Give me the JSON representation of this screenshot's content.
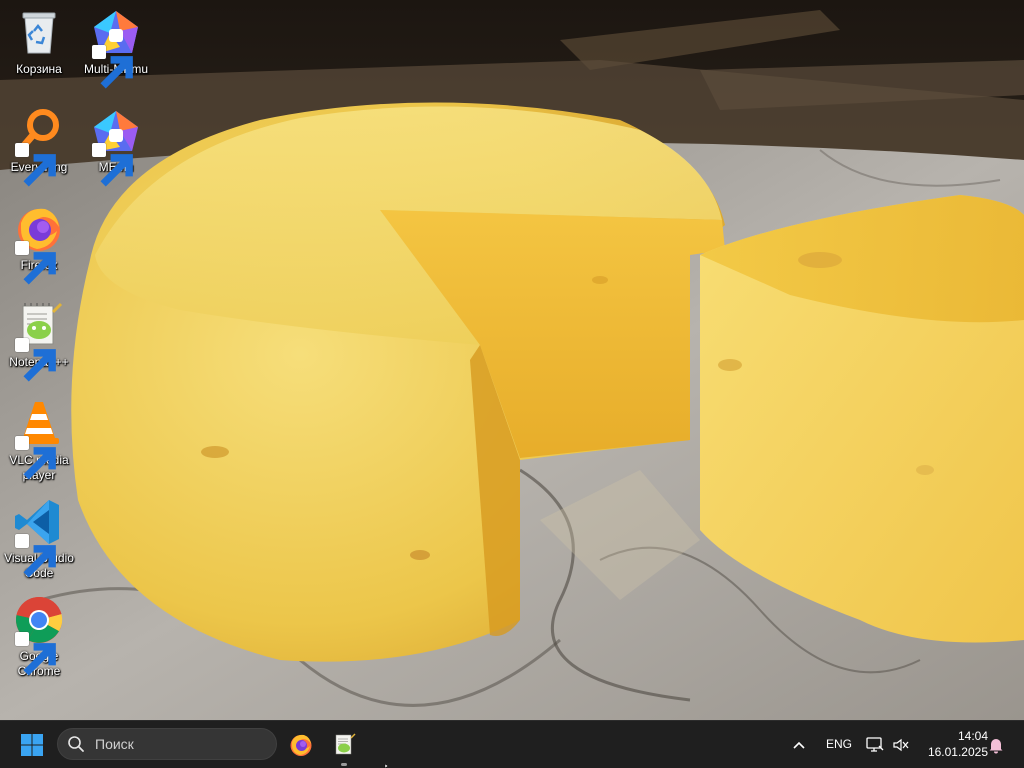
{
  "desktop": {
    "icons": [
      {
        "label": "Корзина",
        "icon": "recycle-bin-icon",
        "shortcut": false
      },
      {
        "label": "Multi-MEmu",
        "icon": "multi-memu-icon",
        "shortcut": true
      },
      {
        "label": "Everything",
        "icon": "everything-search-icon",
        "shortcut": true
      },
      {
        "label": "MEmu",
        "icon": "memu-icon",
        "shortcut": true
      },
      {
        "label": "Firefox",
        "icon": "firefox-icon",
        "shortcut": true
      },
      {
        "label": "Notepad++",
        "icon": "notepad-plus-plus-icon",
        "shortcut": true
      },
      {
        "label": "VLC media player",
        "icon": "vlc-icon",
        "shortcut": true
      },
      {
        "label": "Visual Studio Code",
        "icon": "vscode-icon",
        "shortcut": true
      },
      {
        "label": "Google Chrome",
        "icon": "chrome-icon",
        "shortcut": true
      }
    ]
  },
  "wallpaper": {
    "subject": "cheese wheel wallpaper",
    "icon": "wallpaper-image"
  },
  "taskbar": {
    "start": {
      "icon": "windows-start-icon"
    },
    "search": {
      "placeholder": "Поиск",
      "icon": "search-icon"
    },
    "pinned": [
      {
        "name": "Firefox",
        "icon": "firefox-icon",
        "running": false
      },
      {
        "name": "Notepad++",
        "icon": "notepad-plus-plus-icon",
        "running": true
      }
    ],
    "tray": {
      "chevron_icon": "chevron-up-icon",
      "language": "ENG",
      "network_icon": "network-icon",
      "volume_icon": "volume-muted-icon",
      "time": "14:04",
      "date": "16.01.2025",
      "notification_icon": "bell-icon"
    }
  },
  "colors": {
    "taskbar_bg": "#1f1f1f",
    "search_bg": "#353535",
    "start_accent": "#3aa4f2",
    "notification_accent": "#f5c0d8"
  }
}
